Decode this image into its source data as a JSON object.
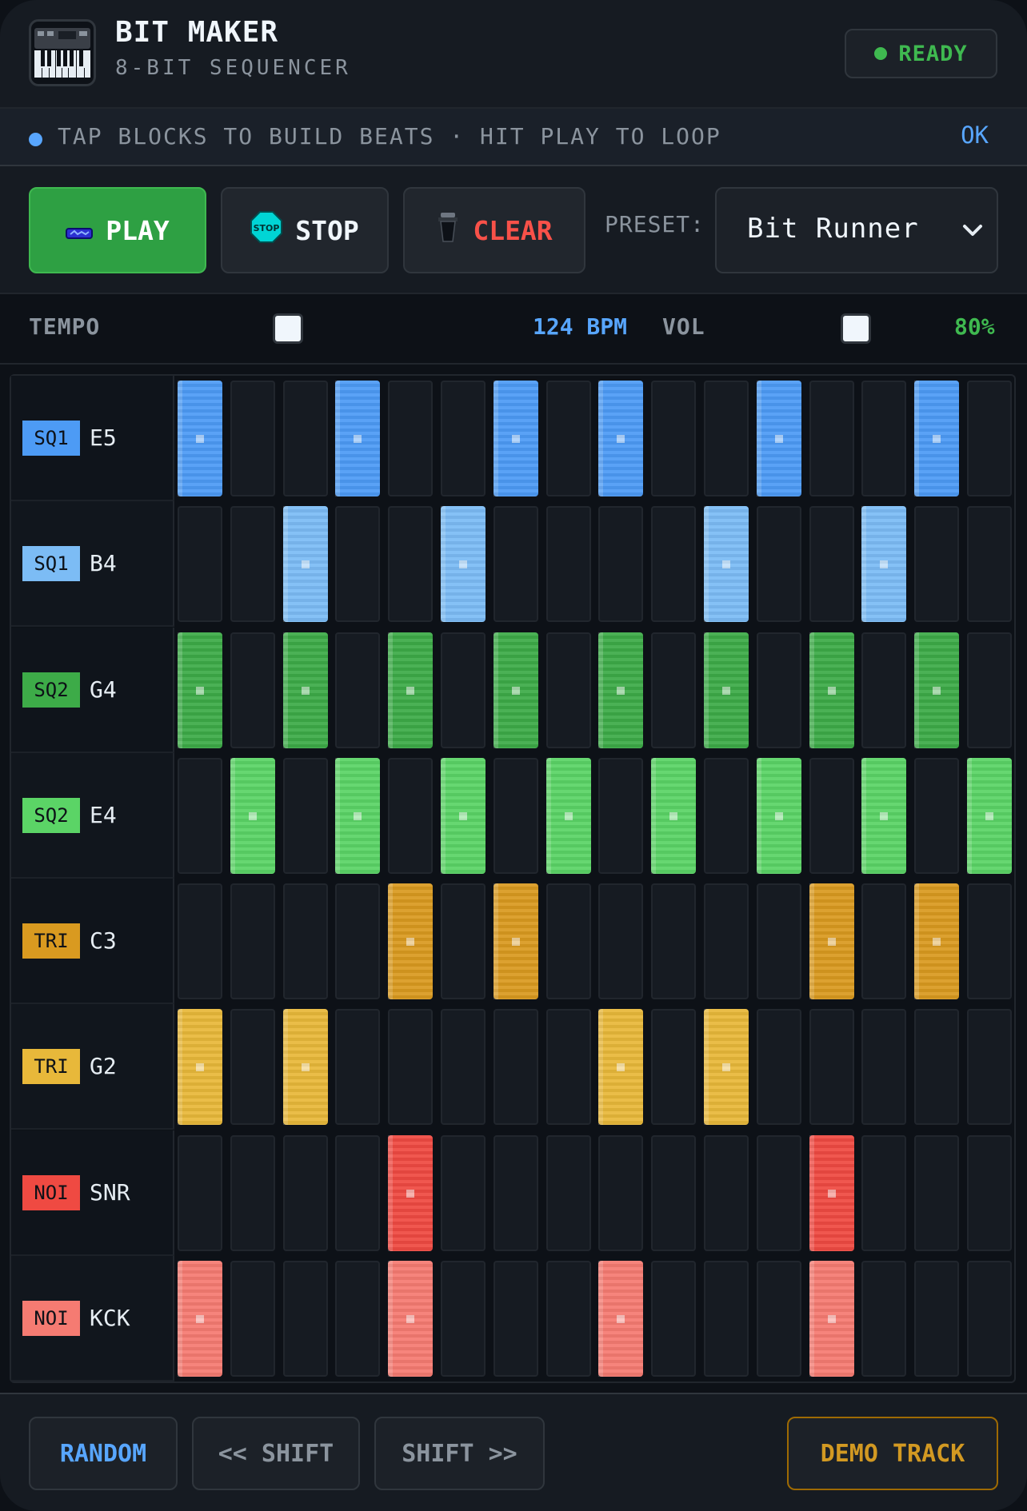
{
  "header": {
    "title": "BIT MAKER",
    "subtitle": "8-BIT SEQUENCER",
    "logo_icon": "piano-keyboard-icon",
    "status": "READY"
  },
  "banner": {
    "text": "TAP BLOCKS TO BUILD BEATS · HIT PLAY TO LOOP",
    "ok": "OK"
  },
  "controls": {
    "play": "PLAY",
    "stop": "STOP",
    "clear": "CLEAR",
    "preset_label": "PRESET:",
    "preset_value": "Bit Runner"
  },
  "sliders": {
    "tempo_label": "TEMPO",
    "tempo_value": "124 BPM",
    "vol_label": "VOL",
    "vol_value": "80%"
  },
  "colors": {
    "blue": "#4d9bf5",
    "light_blue": "#7cbcf5",
    "green": "#3dab48",
    "light_green": "#5bd466",
    "orange": "#d99a20",
    "yellow": "#e8b83a",
    "red": "#ef4a42",
    "light_red": "#f57b72"
  },
  "tracks": [
    {
      "badge": "SQ1",
      "note": "E5",
      "color": "#4d9bf5",
      "badge_color": "#4d9bf5",
      "steps": [
        1,
        0,
        0,
        1,
        0,
        0,
        1,
        0,
        1,
        0,
        0,
        1,
        0,
        0,
        1,
        0
      ]
    },
    {
      "badge": "SQ1",
      "note": "B4",
      "color": "#7cbcf5",
      "badge_color": "#7cbcf5",
      "steps": [
        0,
        0,
        1,
        0,
        0,
        1,
        0,
        0,
        0,
        0,
        1,
        0,
        0,
        1,
        0,
        0
      ]
    },
    {
      "badge": "SQ2",
      "note": "G4",
      "color": "#3dab48",
      "badge_color": "#3dab48",
      "steps": [
        1,
        0,
        1,
        0,
        1,
        0,
        1,
        0,
        1,
        0,
        1,
        0,
        1,
        0,
        1,
        0
      ]
    },
    {
      "badge": "SQ2",
      "note": "E4",
      "color": "#5bd466",
      "badge_color": "#5bd466",
      "steps": [
        0,
        1,
        0,
        1,
        0,
        1,
        0,
        1,
        0,
        1,
        0,
        1,
        0,
        1,
        0,
        1
      ]
    },
    {
      "badge": "TRI",
      "note": "C3",
      "color": "#d99a20",
      "badge_color": "#d99a20",
      "steps": [
        0,
        0,
        0,
        0,
        1,
        0,
        1,
        0,
        0,
        0,
        0,
        0,
        1,
        0,
        1,
        0
      ]
    },
    {
      "badge": "TRI",
      "note": "G2",
      "color": "#e8b83a",
      "badge_color": "#e8b83a",
      "steps": [
        1,
        0,
        1,
        0,
        0,
        0,
        0,
        0,
        1,
        0,
        1,
        0,
        0,
        0,
        0,
        0
      ]
    },
    {
      "badge": "NOI",
      "note": "SNR",
      "color": "#ef4a42",
      "badge_color": "#ef4a42",
      "steps": [
        0,
        0,
        0,
        0,
        1,
        0,
        0,
        0,
        0,
        0,
        0,
        0,
        1,
        0,
        0,
        0
      ]
    },
    {
      "badge": "NOI",
      "note": "KCK",
      "color": "#f57b72",
      "badge_color": "#f57b72",
      "steps": [
        1,
        0,
        0,
        0,
        1,
        0,
        0,
        0,
        1,
        0,
        0,
        0,
        1,
        0,
        0,
        0
      ]
    }
  ],
  "footer": {
    "random": "RANDOM",
    "shift_left": "<< SHIFT",
    "shift_right": "SHIFT >>",
    "demo": "DEMO TRACK"
  }
}
